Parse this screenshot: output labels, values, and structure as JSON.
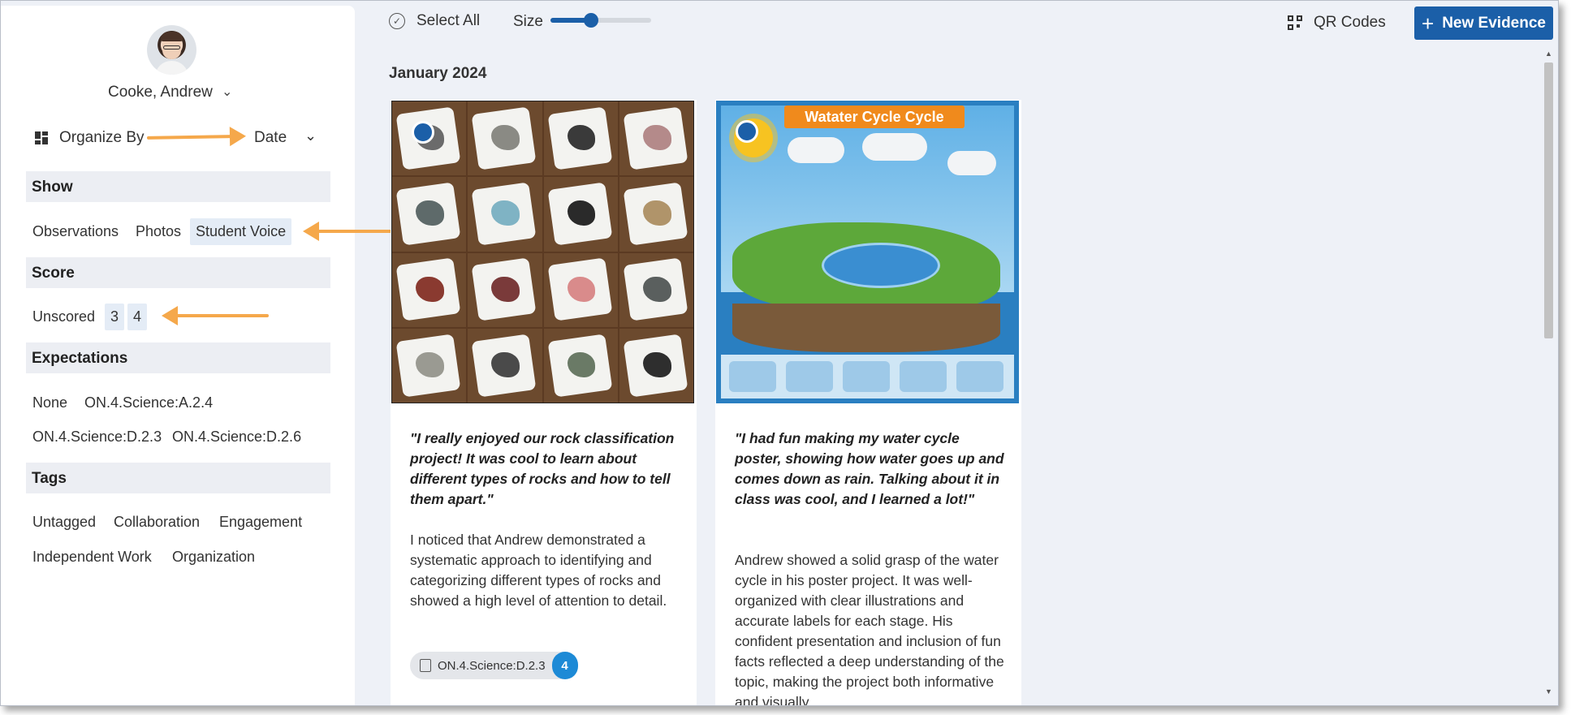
{
  "user": {
    "name": "Cooke, Andrew"
  },
  "organize": {
    "label": "Organize By",
    "value": "Date"
  },
  "filters": {
    "show": {
      "title": "Show",
      "items": [
        "Observations",
        "Photos",
        "Student Voice"
      ]
    },
    "score": {
      "title": "Score",
      "items": [
        "Unscored",
        "3",
        "4"
      ]
    },
    "expectations": {
      "title": "Expectations",
      "items": [
        "None",
        "ON.4.Science:A.2.4",
        "ON.4.Science:D.2.3",
        "ON.4.Science:D.2.6"
      ]
    },
    "tags": {
      "title": "Tags",
      "items": [
        "Untagged",
        "Collaboration",
        "Engagement",
        "Independent Work",
        "Organization"
      ]
    }
  },
  "toolbar": {
    "select_all": "Select All",
    "size_label": "Size",
    "size_value": 0.4,
    "qr_codes": "QR Codes",
    "new_evidence": "New Evidence"
  },
  "group": {
    "title": "January 2024"
  },
  "cards": [
    {
      "quote": "\"I really enjoyed our rock classification project! It was cool to learn about different types of rocks and how to tell them apart.\"",
      "body": "I noticed that Andrew demonstrated a systematic approach to identifying and categorizing different types of rocks and showed a high level of attention to detail.",
      "tag": "ON.4.Science:D.2.3",
      "score": "4"
    },
    {
      "poster_title": "Watater Cycle Cycle",
      "quote": "\"I had fun making my water cycle poster, showing how water goes up and comes down as rain. Talking about it in class was cool, and I learned a lot!\"",
      "body": "Andrew showed a solid grasp of the water cycle in his poster project. It was well-organized with clear illustrations and accurate labels for each stage. His confident presentation and inclusion of fun facts reflected a deep understanding of the topic, making the project both informative and visually"
    }
  ],
  "colors": {
    "accent": "#1b5fa8",
    "score_badge": "#1d8ad6",
    "annotation_arrow": "#f5a84b"
  }
}
